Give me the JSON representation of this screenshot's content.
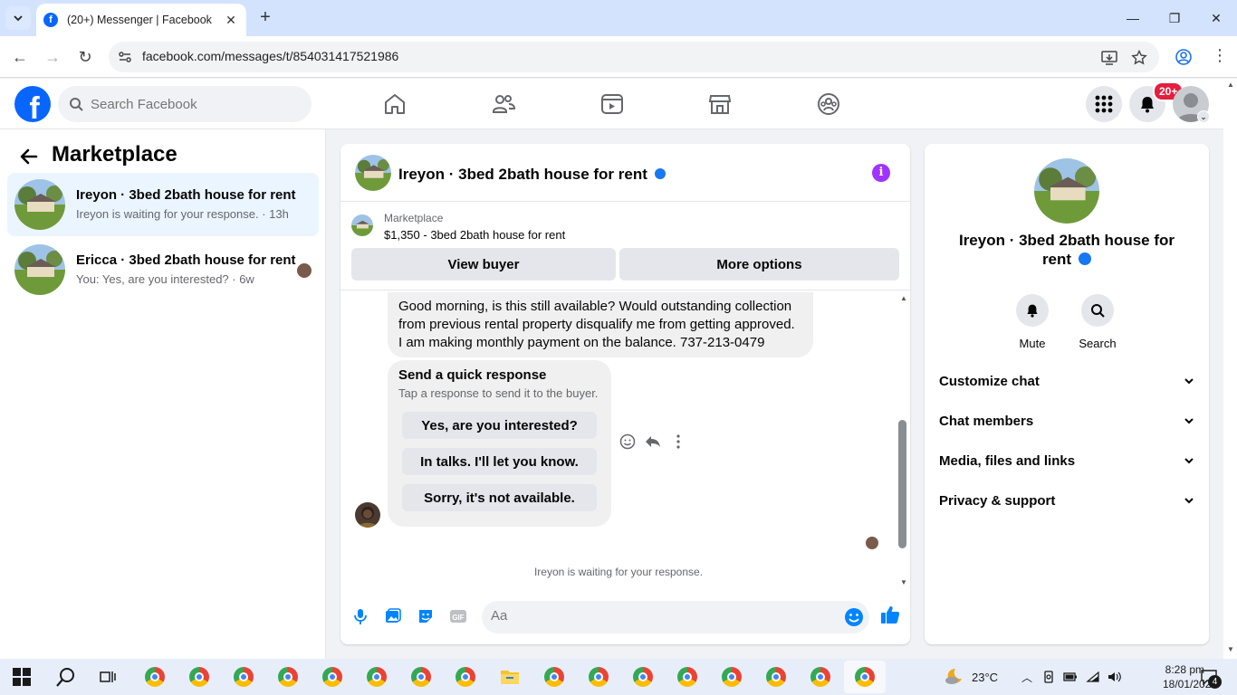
{
  "browser": {
    "tab_title": "(20+) Messenger | Facebook",
    "url": "facebook.com/messages/t/854031417521986"
  },
  "fb_header": {
    "search_placeholder": "Search Facebook",
    "notifications_badge": "20+"
  },
  "left_panel": {
    "title": "Marketplace",
    "conversations": [
      {
        "name": "Ireyon · 3bed 2bath house for rent",
        "preview": "Ireyon is waiting for your response. · 13h",
        "active": true
      },
      {
        "name": "Ericca · 3bed 2bath house for rent",
        "preview": "You: Yes, are you interested? · 6w",
        "active": false
      }
    ]
  },
  "chat": {
    "header_name": "Ireyon · 3bed 2bath house for rent",
    "marketplace_label": "Marketplace",
    "listing": "$1,350 - 3bed 2bath house for rent",
    "view_buyer": "View buyer",
    "more_options": "More options",
    "message_lines": [
      "Good morning, is this still available? Would outstanding collection",
      "from previous rental property disqualify me from getting approved.",
      "I am making monthly payment on the balance. 737-213-0479"
    ],
    "quick_response_title": "Send a quick response",
    "quick_response_sub": "Tap a response to send it to the buyer.",
    "quick_responses": [
      "Yes, are you interested?",
      "In talks. I'll let you know.",
      "Sorry, it's not available."
    ],
    "waiting_text": "Ireyon is waiting for your response.",
    "composer_placeholder": "Aa"
  },
  "right_panel": {
    "name": "Ireyon · 3bed 2bath house for rent",
    "mute": "Mute",
    "search": "Search",
    "sections": [
      "Customize chat",
      "Chat members",
      "Media, files and links",
      "Privacy & support"
    ]
  },
  "taskbar": {
    "temperature": "23°C",
    "time": "8:28 pm",
    "date": "18/01/2026",
    "notif_count": "4"
  },
  "colors": {
    "fb_blue": "#0866ff",
    "active_conv_bg": "#ebf5ff",
    "info_purple": "#a033ff",
    "composer_icon_blue": "#0084ff"
  }
}
